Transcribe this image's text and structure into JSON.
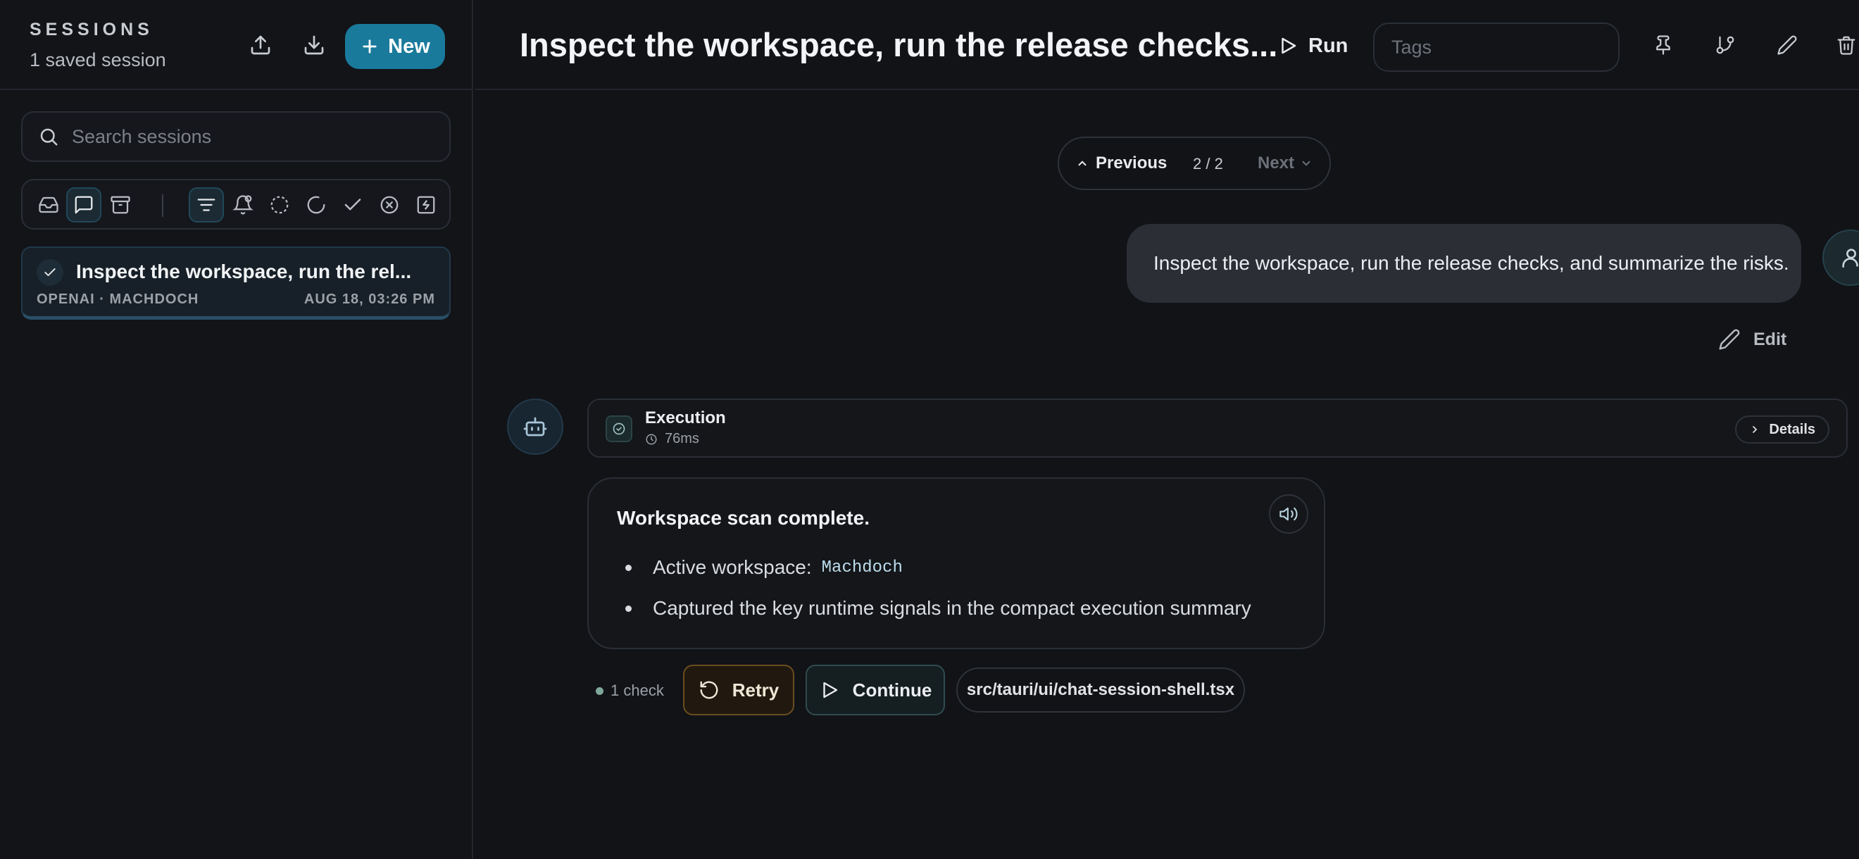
{
  "sidebar": {
    "title": "SESSIONS",
    "count_label": "1 saved session",
    "new_label": "New",
    "search_placeholder": "Search sessions",
    "sessions": [
      {
        "title": "Inspect the workspace, run the rel...",
        "meta": "OPENAI · MACHDOCH",
        "date": "AUG 18, 03:26 PM",
        "status": "completed"
      }
    ]
  },
  "header": {
    "title": "Inspect the workspace, run the release checks...",
    "run_label": "Run",
    "tags_placeholder": "Tags"
  },
  "pager": {
    "previous_label": "Previous",
    "count": "2 / 2",
    "next_label": "Next"
  },
  "conversation": {
    "user_message": "Inspect the workspace, run the release checks, and summarize the risks.",
    "edit_label": "Edit",
    "execution": {
      "title": "Execution",
      "duration": "76ms",
      "details_label": "Details"
    },
    "reply": {
      "heading": "Workspace scan complete.",
      "bullet1_label": "Active workspace:",
      "bullet1_code": "Machdoch",
      "bullet2": "Captured the key runtime signals in the compact execution summary"
    },
    "actions": {
      "check_label": "1 check",
      "retry_label": "Retry",
      "continue_label": "Continue",
      "file": "src/tauri/ui/chat-session-shell.tsx"
    }
  },
  "colors": {
    "background": "#111317",
    "accent": "#1a7a9b",
    "retry_border": "#6a4d1f",
    "continue_border": "#2f4c4f"
  }
}
